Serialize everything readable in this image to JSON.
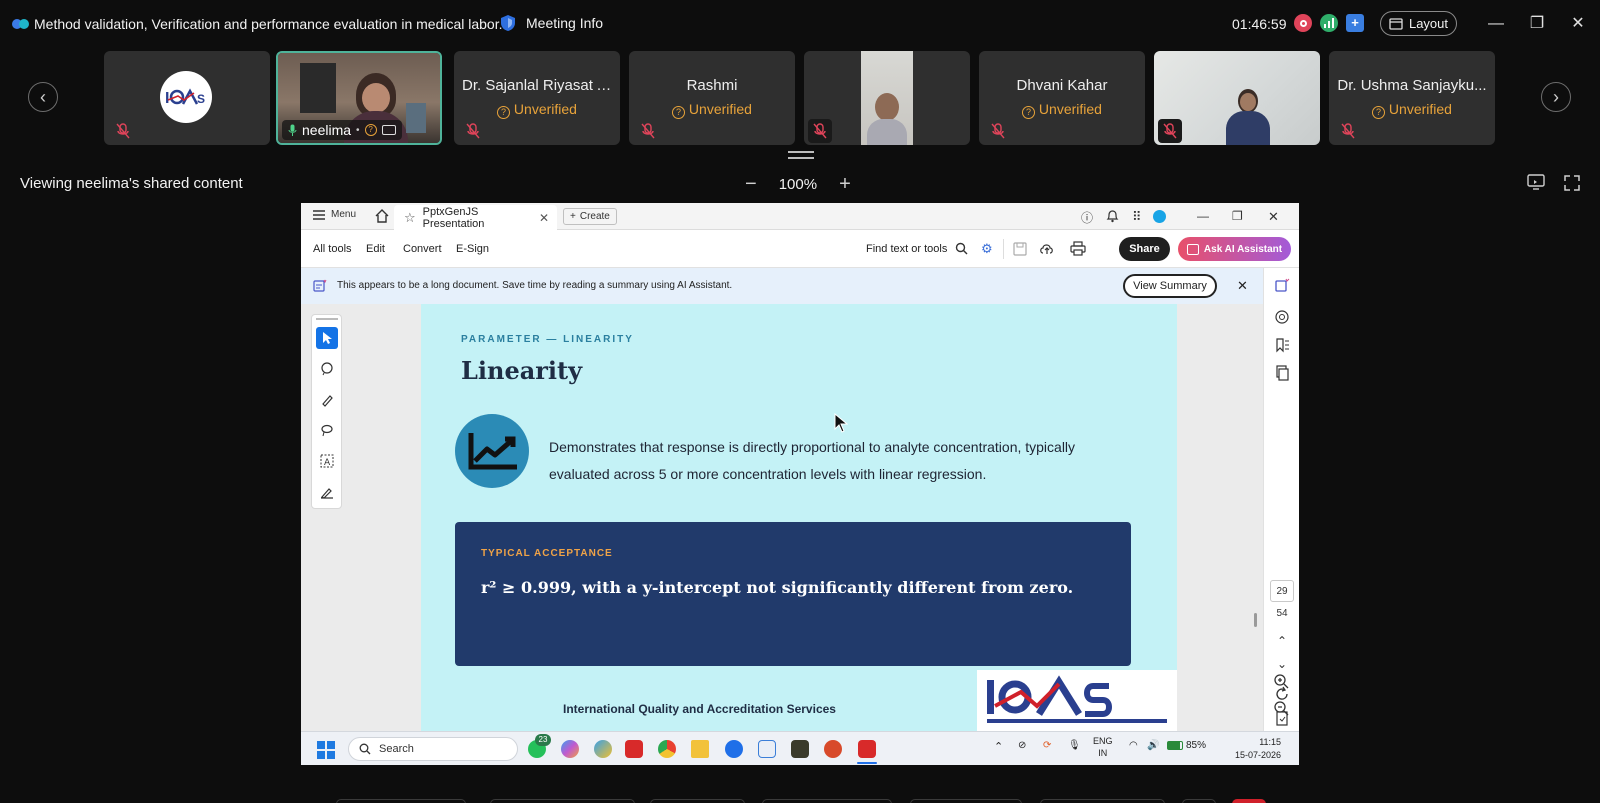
{
  "meeting": {
    "title": "Method validation, Verification and performance evaluation in medical labor...",
    "info_label": "Meeting Info",
    "timer": "01:46:59",
    "layout_label": "Layout"
  },
  "participants": [
    {
      "name": "",
      "status": "",
      "kind": "logo"
    },
    {
      "name": "neelima",
      "status": "",
      "kind": "video"
    },
    {
      "name": "Dr. Sajanlal Riyasat Ali",
      "status": "Unverified",
      "kind": "name"
    },
    {
      "name": "Rashmi",
      "status": "Unverified",
      "kind": "name"
    },
    {
      "name": "",
      "status": "",
      "kind": "video"
    },
    {
      "name": "Dhvani Kahar",
      "status": "Unverified",
      "kind": "name"
    },
    {
      "name": "",
      "status": "",
      "kind": "video"
    },
    {
      "name": "Dr. Ushma Sanjayku...",
      "status": "Unverified",
      "kind": "name"
    }
  ],
  "share": {
    "caption": "Viewing neelima's shared content",
    "zoom": "100%"
  },
  "acrobat": {
    "menu_label": "Menu",
    "tab_title": "PptxGenJS Presentation",
    "create_label": "Create",
    "tools": [
      "All tools",
      "Edit",
      "Convert",
      "E-Sign"
    ],
    "find_label": "Find text or tools",
    "share_label": "Share",
    "ai_label": "Ask AI Assistant",
    "banner_text": "This appears to be a long document. Save time by reading a summary using AI Assistant.",
    "view_summary": "View Summary",
    "page_current": "29",
    "page_total": "54"
  },
  "slide": {
    "kicker": "PARAMETER — LINEARITY",
    "title": "Linearity",
    "description": "Demonstrates that response is directly proportional to analyte concentration, typically evaluated across 5 or more concentration levels with linear regression.",
    "accept_label": "TYPICAL ACCEPTANCE",
    "accept_text": "r² ≥ 0.999, with a y-intercept not significantly different from zero.",
    "footer": "International Quality and Accreditation Services",
    "logo_text": "IQAS"
  },
  "taskbar": {
    "search_label": "Search",
    "whatsapp_badge": "23",
    "lang_top": "ENG",
    "lang_bottom": "IN",
    "battery": "85%",
    "time": "11:15",
    "date": "15-07-2026"
  },
  "colors": {
    "unverified": "#e8a33a",
    "active_tile_border": "#4fb39a",
    "slide_bg": "#c4f2f6",
    "accept_box": "#213a6b",
    "accept_label": "#f0a347"
  }
}
